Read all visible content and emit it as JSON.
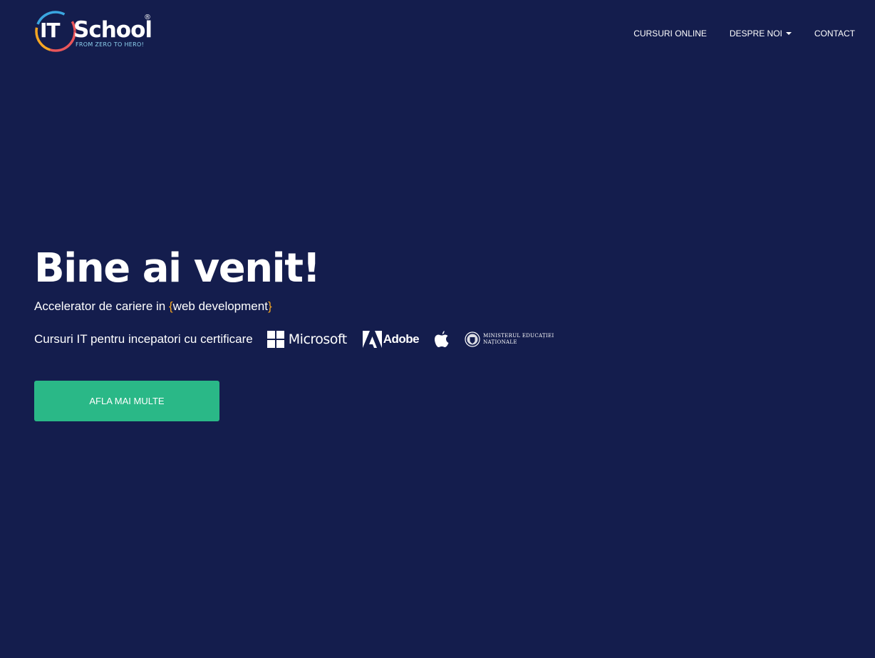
{
  "logo": {
    "mark": "IT",
    "name": "School",
    "registered": "®",
    "tagline": "FROM ZERO TO HERO!"
  },
  "nav": {
    "items": [
      {
        "label": "CURSURI ONLINE"
      },
      {
        "label": "DESPRE NOI",
        "has_dropdown": true
      },
      {
        "label": "CONTACT"
      }
    ]
  },
  "hero": {
    "title": "Bine ai venit!",
    "subtitle_prefix": "Accelerator de cariere in ",
    "brace_open": "{",
    "subtitle_highlight": "web development",
    "brace_close": "}",
    "certification_label": "Cursuri IT pentru incepatori cu certificare",
    "partners": {
      "microsoft": "Microsoft",
      "adobe": "Adobe",
      "apple_icon": "apple-icon",
      "ministry_line1": "MINISTERUL EDUCAȚIEI",
      "ministry_line2": "NAȚIONALE"
    },
    "cta_label": "AFLA MAI MULTE"
  },
  "colors": {
    "background": "#141d4d",
    "accent_green": "#2ab887",
    "brace_orange": "#f5a623",
    "text": "#ffffff"
  }
}
